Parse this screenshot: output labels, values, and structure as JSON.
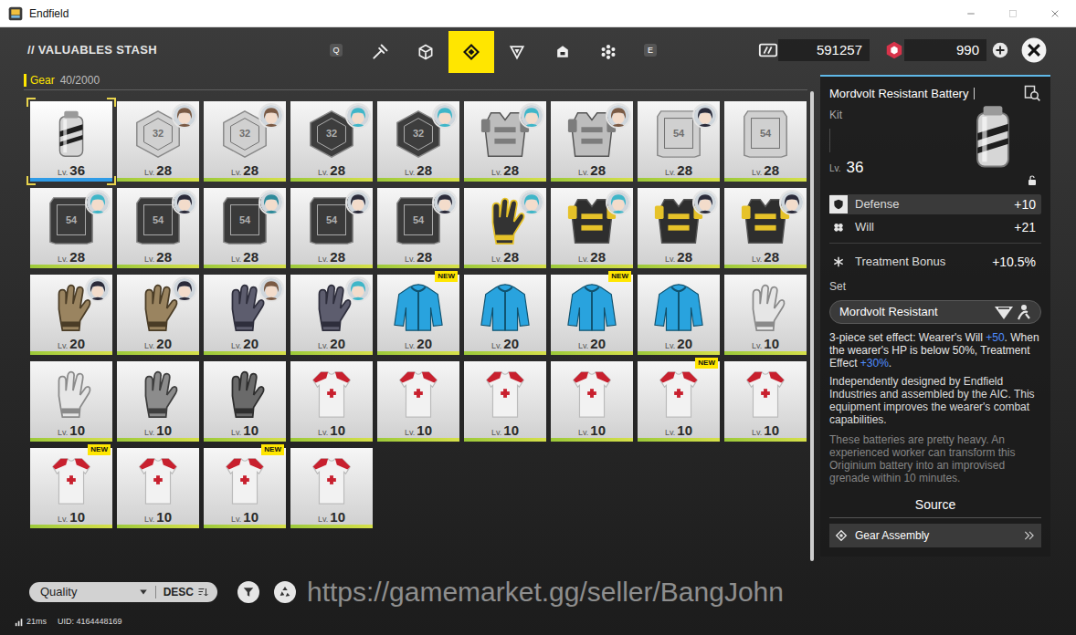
{
  "window": {
    "title": "Endfield"
  },
  "header": {
    "title": "// VALUABLES STASH",
    "prev_key": "Q",
    "next_key": "E",
    "tabs": [
      {
        "kind": "weapon",
        "selected": false
      },
      {
        "kind": "cube",
        "selected": false
      },
      {
        "kind": "gear",
        "selected": true
      },
      {
        "kind": "triangle",
        "selected": false
      },
      {
        "kind": "box",
        "selected": false
      },
      {
        "kind": "flower",
        "selected": false
      }
    ],
    "currencies": [
      {
        "kind": "card",
        "value": "591257"
      },
      {
        "kind": "gem",
        "value": "990"
      }
    ]
  },
  "category": {
    "label": "Gear",
    "count": "40/2000"
  },
  "labels": {
    "level": "Lv.",
    "new_badge": "NEW"
  },
  "items": [
    {
      "kind": "battery",
      "color": "#d6d6d6",
      "accent": "#1e1e1e",
      "level": "36",
      "selected": true,
      "new": false
    },
    {
      "kind": "hexplate",
      "color": "#d0d0d0",
      "accent": "#6e6e6e",
      "plate_text": "32",
      "level": "28",
      "selected": false,
      "new": false,
      "avatar_color": "#7a5a44"
    },
    {
      "kind": "hexplate",
      "color": "#d0d0d0",
      "accent": "#6e6e6e",
      "plate_text": "32",
      "level": "28",
      "selected": false,
      "new": false,
      "avatar_color": "#7a5a44"
    },
    {
      "kind": "hexplate",
      "color": "#3d3d3d",
      "accent": "#b0b0b0",
      "plate_text": "32",
      "level": "28",
      "selected": false,
      "new": false,
      "avatar_color": "#3fb6c8"
    },
    {
      "kind": "hexplate",
      "color": "#3d3d3d",
      "accent": "#b0b0b0",
      "plate_text": "32",
      "level": "28",
      "selected": false,
      "new": false,
      "avatar_color": "#3fb6c8"
    },
    {
      "kind": "armor",
      "color": "#bdbdbd",
      "accent": "#7c7c7c",
      "level": "28",
      "selected": false,
      "new": false,
      "avatar_color": "#3fb6c8"
    },
    {
      "kind": "armor",
      "color": "#bdbdbd",
      "accent": "#7c7c7c",
      "level": "28",
      "selected": false,
      "new": false,
      "avatar_color": "#7a5a44"
    },
    {
      "kind": "plate",
      "color": "#d0d0d0",
      "accent": "#6e6e6e",
      "plate_text": "54",
      "level": "28",
      "selected": false,
      "new": false,
      "avatar_color": "#2b2b3a"
    },
    {
      "kind": "plate",
      "color": "#d0d0d0",
      "accent": "#6e6e6e",
      "plate_text": "54",
      "level": "28",
      "selected": false,
      "new": false
    },
    {
      "kind": "plate",
      "color": "#3a3a3a",
      "accent": "#b0b0b0",
      "plate_text": "54",
      "level": "28",
      "selected": false,
      "new": false,
      "avatar_color": "#3fb6c8"
    },
    {
      "kind": "plate",
      "color": "#3a3a3a",
      "accent": "#b0b0b0",
      "plate_text": "54",
      "level": "28",
      "selected": false,
      "new": false,
      "avatar_color": "#2b2b3a"
    },
    {
      "kind": "plate",
      "color": "#3a3a3a",
      "accent": "#b0b0b0",
      "plate_text": "54",
      "level": "28",
      "selected": false,
      "new": false,
      "avatar_color": "#2e8a9a"
    },
    {
      "kind": "plate",
      "color": "#3a3a3a",
      "accent": "#b0b0b0",
      "plate_text": "54",
      "level": "28",
      "selected": false,
      "new": false,
      "avatar_color": "#2b2b3a"
    },
    {
      "kind": "plate",
      "color": "#3a3a3a",
      "accent": "#b0b0b0",
      "plate_text": "54",
      "level": "28",
      "selected": false,
      "new": false,
      "avatar_color": "#2b2b3a"
    },
    {
      "kind": "gloves",
      "color": "#333333",
      "accent": "#e6c229",
      "level": "28",
      "selected": false,
      "new": false,
      "avatar_color": "#3fb6c8"
    },
    {
      "kind": "armor",
      "color": "#2e2e2e",
      "accent": "#e6c229",
      "level": "28",
      "selected": false,
      "new": false,
      "avatar_color": "#3fb6c8"
    },
    {
      "kind": "armor",
      "color": "#2e2e2e",
      "accent": "#e6c229",
      "level": "28",
      "selected": false,
      "new": false,
      "avatar_color": "#2b2b3a"
    },
    {
      "kind": "armor",
      "color": "#2e2e2e",
      "accent": "#e6c229",
      "level": "28",
      "selected": false,
      "new": false,
      "avatar_color": "#2b2b3a"
    },
    {
      "kind": "gloves",
      "color": "#9a8460",
      "accent": "#4a3c26",
      "level": "20",
      "selected": false,
      "new": false,
      "avatar_color": "#2b2b3a"
    },
    {
      "kind": "gloves",
      "color": "#9a8460",
      "accent": "#4a3c26",
      "level": "20",
      "selected": false,
      "new": false,
      "avatar_color": "#2b2b3a"
    },
    {
      "kind": "gloves",
      "color": "#5d5d6e",
      "accent": "#2e2e3c",
      "level": "20",
      "selected": false,
      "new": false,
      "avatar_color": "#7a5a44"
    },
    {
      "kind": "gloves",
      "color": "#5d5d6e",
      "accent": "#2e2e3c",
      "level": "20",
      "selected": false,
      "new": false,
      "avatar_color": "#3fb6c8"
    },
    {
      "kind": "jacket",
      "color": "#29a3de",
      "accent": "#10526f",
      "level": "20",
      "selected": false,
      "new": true
    },
    {
      "kind": "jacket",
      "color": "#29a3de",
      "accent": "#10526f",
      "level": "20",
      "selected": false,
      "new": false
    },
    {
      "kind": "jacket",
      "color": "#29a3de",
      "accent": "#10526f",
      "level": "20",
      "selected": false,
      "new": true
    },
    {
      "kind": "jacket",
      "color": "#29a3de",
      "accent": "#10526f",
      "level": "20",
      "selected": false,
      "new": false
    },
    {
      "kind": "gloves",
      "color": "#e6e6e6",
      "accent": "#8a8a8a",
      "level": "10",
      "selected": false,
      "new": false
    },
    {
      "kind": "gloves",
      "color": "#e6e6e6",
      "accent": "#8a8a8a",
      "level": "10",
      "selected": false,
      "new": false
    },
    {
      "kind": "gloves",
      "color": "#8c8c8c",
      "accent": "#3e3e3e",
      "level": "10",
      "selected": false,
      "new": false
    },
    {
      "kind": "gloves",
      "color": "#6a6a6a",
      "accent": "#2e2e2e",
      "level": "10",
      "selected": false,
      "new": false
    },
    {
      "kind": "shirt",
      "color": "#f2f2f2",
      "accent": "#c8202e",
      "level": "10",
      "selected": false,
      "new": false
    },
    {
      "kind": "shirt",
      "color": "#f2f2f2",
      "accent": "#c8202e",
      "level": "10",
      "selected": false,
      "new": false
    },
    {
      "kind": "shirt",
      "color": "#f2f2f2",
      "accent": "#c8202e",
      "level": "10",
      "selected": false,
      "new": false
    },
    {
      "kind": "shirt",
      "color": "#f2f2f2",
      "accent": "#c8202e",
      "level": "10",
      "selected": false,
      "new": false
    },
    {
      "kind": "shirt",
      "color": "#f2f2f2",
      "accent": "#c8202e",
      "level": "10",
      "selected": false,
      "new": true
    },
    {
      "kind": "shirt",
      "color": "#f2f2f2",
      "accent": "#c8202e",
      "level": "10",
      "selected": false,
      "new": false
    },
    {
      "kind": "shirt",
      "color": "#f2f2f2",
      "accent": "#c8202e",
      "level": "10",
      "selected": false,
      "new": true
    },
    {
      "kind": "shirt",
      "color": "#f2f2f2",
      "accent": "#c8202e",
      "level": "10",
      "selected": false,
      "new": false
    },
    {
      "kind": "shirt",
      "color": "#f2f2f2",
      "accent": "#c8202e",
      "level": "10",
      "selected": false,
      "new": true
    },
    {
      "kind": "shirt",
      "color": "#f2f2f2",
      "accent": "#c8202e",
      "level": "10",
      "selected": false,
      "new": false
    }
  ],
  "detail": {
    "name": "Mordvolt Resistant Battery",
    "type": "Kit",
    "level_label": "Lv.",
    "level": "36",
    "stats": [
      {
        "kind": "defense",
        "label": "Defense",
        "value": "+10",
        "highlighted": true
      },
      {
        "kind": "will",
        "label": "Will",
        "value": "+21",
        "highlighted": false
      },
      {
        "kind": "treatment",
        "label": "Treatment Bonus",
        "value": "+10.5%",
        "highlighted": false
      }
    ],
    "set_label": "Set",
    "set_name": "Mordvolt Resistant",
    "set_effect": [
      {
        "text": "3-piece set effect: Wearer's Will ",
        "highlight": false
      },
      {
        "text": "+50",
        "highlight": true
      },
      {
        "text": ". When the wearer's HP is below 50%, Treatment Effect ",
        "highlight": false
      },
      {
        "text": "+30%",
        "highlight": true
      },
      {
        "text": ".",
        "highlight": false
      }
    ],
    "description": "Independently designed by Endfield Industries and assembled by the AIC. This equipment improves the wearer's combat capabilities.",
    "flavor": "These batteries are pretty heavy. An experienced worker can transform this Originium battery into an improvised grenade within 10 minutes.",
    "source_label": "Source",
    "sources": [
      "Gear Assembly"
    ]
  },
  "toolbar": {
    "sort": "Quality",
    "order": "DESC"
  },
  "watermark": "https://gamemarket.gg/seller/BangJohn",
  "status": {
    "ping": "21ms",
    "uid": "UID: 4164448169"
  }
}
